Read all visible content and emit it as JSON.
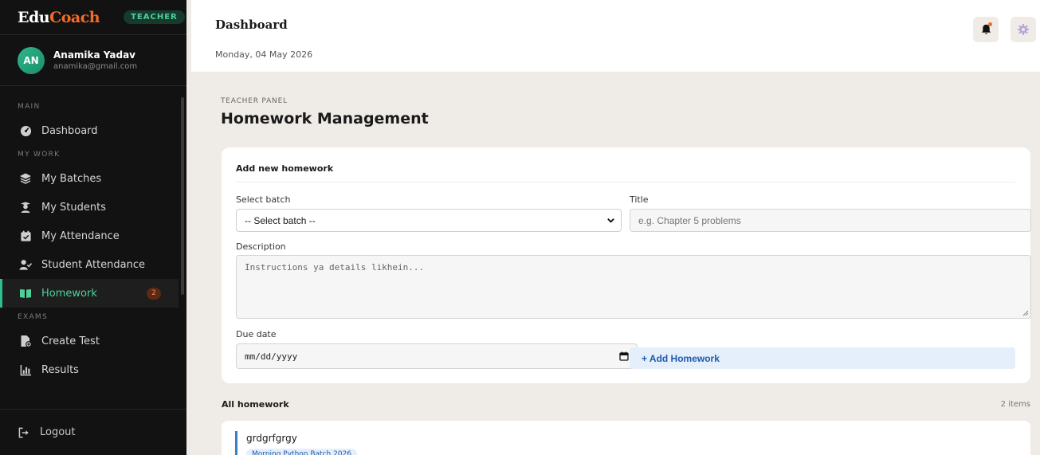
{
  "brand": {
    "part1": "Edu",
    "part2": "Coach",
    "role_badge": "TEACHER"
  },
  "user": {
    "initials": "AN",
    "name": "Anamika Yadav",
    "email": "anamika@gmail.com"
  },
  "nav": {
    "sections": {
      "main": "MAIN",
      "my_work": "MY WORK",
      "exams": "EXAMS"
    },
    "items": {
      "dashboard": "Dashboard",
      "my_batches": "My Batches",
      "my_students": "My Students",
      "my_attendance": "My Attendance",
      "student_attendance": "Student Attendance",
      "homework": "Homework",
      "homework_badge": "2",
      "create_test": "Create Test",
      "results": "Results"
    },
    "logout": "Logout",
    "active": "homework"
  },
  "topbar": {
    "title": "Dashboard",
    "date": "Monday, 04 May 2026"
  },
  "page": {
    "panel_label": "TEACHER PANEL",
    "title": "Homework Management"
  },
  "form": {
    "card_title": "Add new homework",
    "batch_label": "Select batch",
    "batch_value": "-- Select batch --",
    "title_label": "Title",
    "title_placeholder": "e.g. Chapter 5 problems",
    "description_label": "Description",
    "description_placeholder": "Instructions ya details likhein...",
    "due_date_label": "Due date",
    "due_date_placeholder": "mm/dd/yyyy",
    "submit_label": "+ Add Homework"
  },
  "list": {
    "title": "All homework",
    "count": "2 items",
    "items": [
      {
        "title": "grdgrfgrgy",
        "batch": "Morning Python Batch 2026"
      }
    ]
  },
  "colors": {
    "accent_green": "#2fbf8c",
    "brand_orange": "#f26b2a",
    "link_blue": "#1d5aa8",
    "sidebar_bg": "#121212",
    "page_bg": "#efebe6"
  }
}
